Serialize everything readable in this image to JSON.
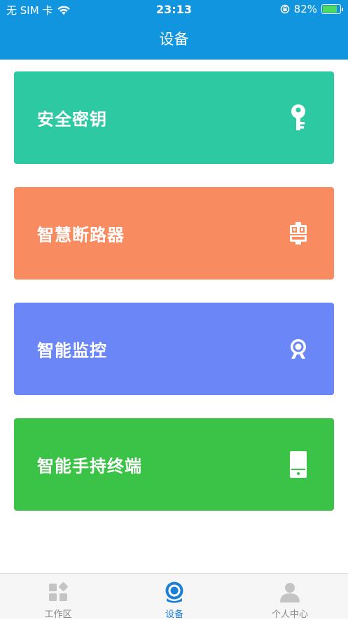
{
  "status_bar": {
    "carrier": "无 SIM 卡",
    "time": "23:13",
    "battery": "82%",
    "battery_level": 0.82
  },
  "header": {
    "title": "设备"
  },
  "cards": [
    {
      "label": "安全密钥",
      "icon": "key-icon",
      "color": "#2dc9a3"
    },
    {
      "label": "智慧断路器",
      "icon": "breaker-icon",
      "color": "#f88b5f"
    },
    {
      "label": "智能监控",
      "icon": "camera-icon",
      "color": "#6a86f7"
    },
    {
      "label": "智能手持终端",
      "icon": "handheld-terminal-icon",
      "color": "#3ac346"
    }
  ],
  "tabbar": {
    "tabs": [
      {
        "label": "工作区",
        "icon": "workspace-grid-icon",
        "active": false
      },
      {
        "label": "设备",
        "icon": "device-camera-icon",
        "active": true
      },
      {
        "label": "个人中心",
        "icon": "person-icon",
        "active": false
      }
    ],
    "active_color": "#1a7fd6",
    "inactive_color": "#c4c4c4"
  }
}
